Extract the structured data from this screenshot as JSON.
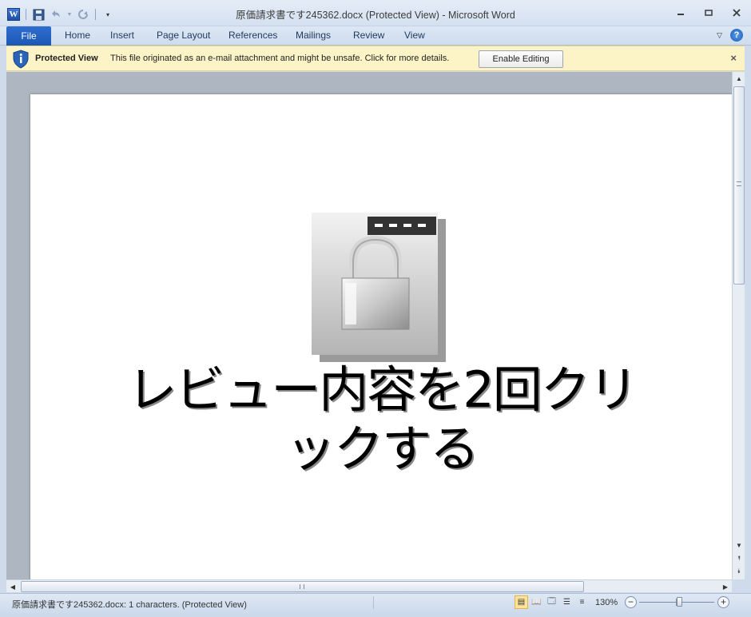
{
  "window": {
    "title": "原価請求書です245362.docx (Protected View)  -  Microsoft Word"
  },
  "quick_access": {
    "app_icon": "W",
    "items": [
      "save-icon",
      "undo-icon",
      "redo-icon",
      "customize-icon"
    ]
  },
  "ribbon": {
    "file_tab": "File",
    "tabs": [
      "Home",
      "Insert",
      "Page Layout",
      "References",
      "Mailings",
      "Review",
      "View"
    ],
    "help": "?"
  },
  "protected_view": {
    "label": "Protected View",
    "message": "This file originated as an e-mail attachment and might be unsafe. Click for more details.",
    "button": "Enable Editing",
    "close": "×"
  },
  "document": {
    "instruction_line1": "レビュー内容を2回クリ",
    "instruction_line2": "ックする"
  },
  "status": {
    "text": "原価請求書です245362.docx: 1 characters.  (Protected View)",
    "zoom": "130%",
    "zoom_value": 130
  },
  "colors": {
    "accent": "#1b57b5",
    "infobar": "#fcf4c7"
  }
}
